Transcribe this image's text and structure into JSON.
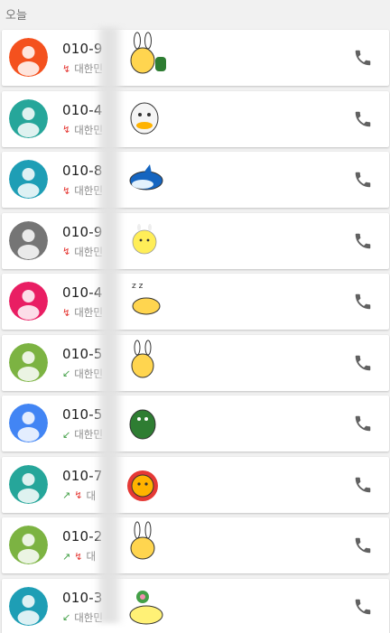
{
  "section_label": "오늘",
  "colors": {
    "missed_arrow": "#e53935",
    "incoming_arrow": "#43a047",
    "call_icon": "#616161"
  },
  "calls": [
    {
      "number": "010-9",
      "location": "대한민",
      "status": "missed",
      "avatar_color": "#f4511e",
      "sticker": "rabbit-kakao-sticker"
    },
    {
      "number": "010-4",
      "location": "대한민",
      "status": "missed",
      "avatar_color": "#26a69a",
      "sticker": "duck-kakao-sticker"
    },
    {
      "number": "010-8",
      "location": "대한민",
      "status": "missed",
      "avatar_color": "#1e9eb5",
      "sticker": "shark-kakao-sticker"
    },
    {
      "number": "010-9",
      "location": "대한민",
      "status": "missed",
      "avatar_color": "#757575",
      "sticker": "chick-kakao-sticker"
    },
    {
      "number": "010-4",
      "location": "대한민",
      "status": "missed",
      "avatar_color": "#e91e63",
      "sticker": "sleeping-kakao-sticker"
    },
    {
      "number": "010-5",
      "location": "대한민",
      "status": "incoming",
      "avatar_color": "#7cb342",
      "sticker": "muzi-kakao-sticker"
    },
    {
      "number": "010-5",
      "location": "대한민",
      "status": "incoming",
      "avatar_color": "#4285f4",
      "sticker": "dino-kakao-sticker"
    },
    {
      "number": "010-7",
      "location": "대",
      "status": "outgoing-missed",
      "avatar_color": "#26a69a",
      "sticker": "lion-kakao-sticker"
    },
    {
      "number": "010-2",
      "location": "대",
      "status": "outgoing-missed",
      "avatar_color": "#7cb342",
      "sticker": "rabbit-neo-kakao-sticker"
    },
    {
      "number": "010-3",
      "location": "대한민",
      "status": "incoming",
      "avatar_color": "#1e9eb5",
      "sticker": "bowl-kakao-sticker"
    }
  ]
}
